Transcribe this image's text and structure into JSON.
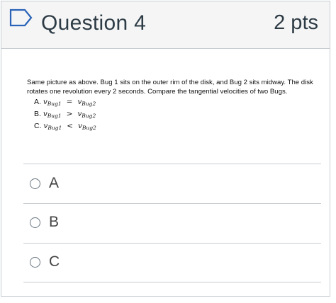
{
  "question": {
    "title": "Question 4",
    "points": "2 pts",
    "text": "Same picture as above. Bug 1 sits on the outer rim of the disk, and Bug 2 sits midway. The disk rotates one revolution every 2 seconds. Compare the tangential velocities of two Bugs.",
    "choices_in_text": [
      {
        "letter": "A.",
        "lhs": "v",
        "lhs_sub": "Bug1",
        "relation": "=",
        "rhs": "v",
        "rhs_sub": "Bug2"
      },
      {
        "letter": "B.",
        "lhs": "v",
        "lhs_sub": "Bug1",
        "relation": ">",
        "rhs": "v",
        "rhs_sub": "Bug2"
      },
      {
        "letter": "C.",
        "lhs": "v",
        "lhs_sub": "Bug1",
        "relation": "<",
        "rhs": "v",
        "rhs_sub": "Bug2"
      }
    ]
  },
  "answers": [
    {
      "label": "A"
    },
    {
      "label": "B"
    },
    {
      "label": "C"
    }
  ]
}
